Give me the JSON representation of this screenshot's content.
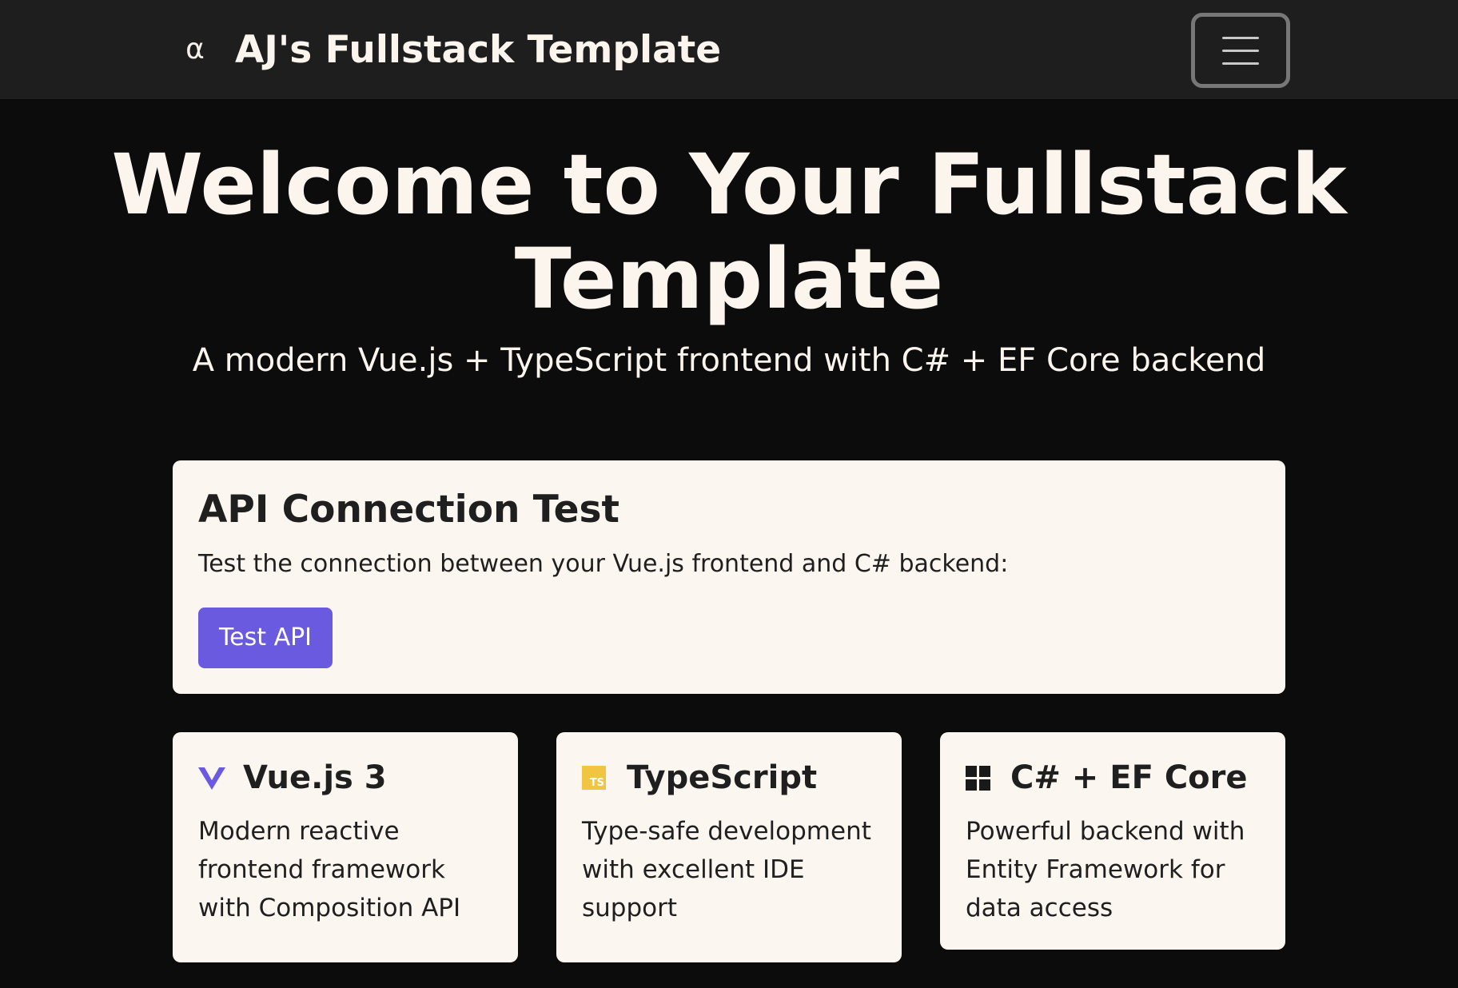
{
  "navbar": {
    "logo_glyph": "α",
    "brand_title": "AJ's Fullstack Template",
    "toggle_icon": "hamburger-menu-icon"
  },
  "hero": {
    "title": "Welcome to Your Fullstack Template",
    "subtitle": "A modern Vue.js + TypeScript frontend with C# + EF Core backend"
  },
  "api_test": {
    "title": "API Connection Test",
    "description": "Test the connection between your Vue.js frontend and C# backend:",
    "button_label": "Test API"
  },
  "features": [
    {
      "icon": "vue-logo-icon",
      "title": "Vue.js 3",
      "description": "Modern reactive frontend framework with Composition API"
    },
    {
      "icon": "typescript-logo-icon",
      "icon_text": "TS",
      "title": "TypeScript",
      "description": "Type-safe development with excellent IDE support"
    },
    {
      "icon": "windows-logo-icon",
      "title": "C# + EF Core",
      "description": "Powerful backend with Entity Framework for data access"
    }
  ],
  "colors": {
    "page_background": "#0c0c0c",
    "navbar_background": "#1e1e1e",
    "card_background": "#fcf6f0",
    "accent": "#6a5ae0",
    "typescript_yellow": "#f2c443"
  }
}
